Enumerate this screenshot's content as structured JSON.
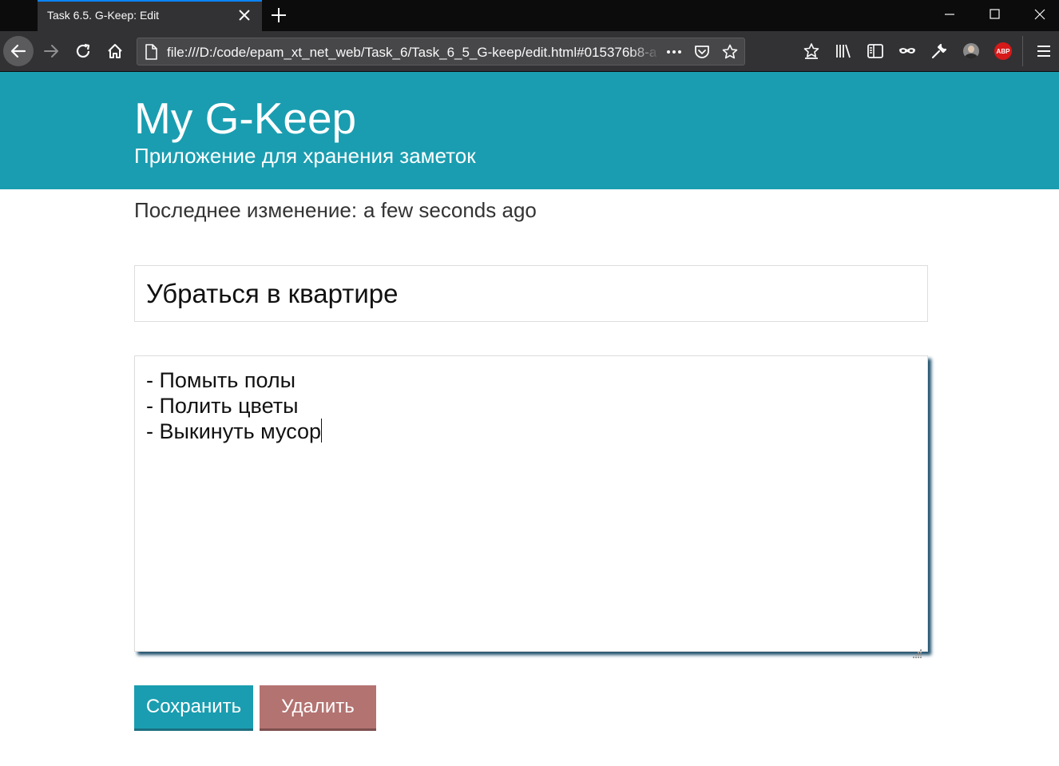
{
  "browser": {
    "tab_title": "Task 6.5. G-Keep: Edit",
    "url": "file:///D:/code/epam_xt_net_web/Task_6/Task_6_5_G-keep/edit.html#015376b8-a",
    "abp_label": "ABP",
    "accent_color": "#0a84ff",
    "icons": [
      "back-icon",
      "forward-icon",
      "reload-icon",
      "home-icon",
      "page-icon",
      "page-actions-icon",
      "pocket-icon",
      "bookmark-star-icon",
      "downloads-icon",
      "library-icon",
      "sidebar-icon",
      "private-mask-icon",
      "wrench-icon",
      "avatar",
      "adblock-icon",
      "hamburger-menu-icon"
    ]
  },
  "header": {
    "title": "My G-Keep",
    "subtitle": "Приложение для хранения заметок",
    "background_color": "#1a9db0"
  },
  "note": {
    "modified_label": "Последнее изменение:",
    "modified_value": "a few seconds ago",
    "title": "Убраться в квартире",
    "body": "- Помыть полы\n- Полить цветы\n- Выкинуть мусор"
  },
  "actions": {
    "save_label": "Сохранить",
    "delete_label": "Удалить",
    "save_color": "#1a9db0",
    "delete_color": "#b37371"
  }
}
